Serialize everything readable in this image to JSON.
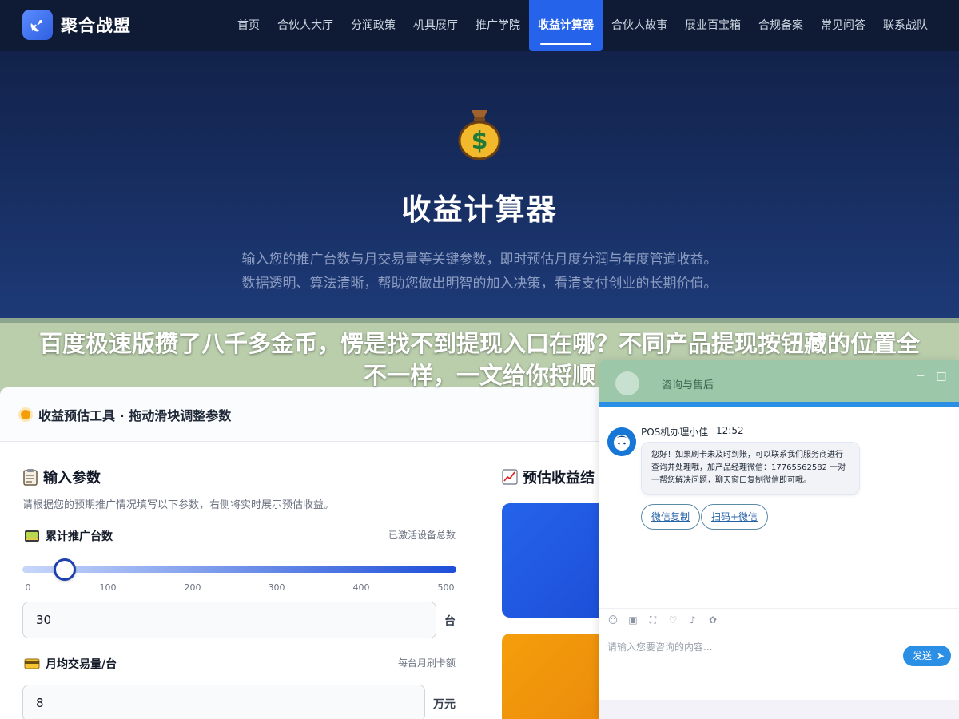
{
  "nav": {
    "brand": "聚合战盟",
    "items": [
      {
        "label": "首页"
      },
      {
        "label": "合伙人大厅"
      },
      {
        "label": "分润政策"
      },
      {
        "label": "机具展厅"
      },
      {
        "label": "推广学院"
      },
      {
        "label": "收益计算器",
        "active": true
      },
      {
        "label": "合伙人故事"
      },
      {
        "label": "展业百宝箱"
      },
      {
        "label": "合规备案"
      },
      {
        "label": "常见问答"
      },
      {
        "label": "联系战队"
      }
    ]
  },
  "hero": {
    "icon": "money-bag-icon",
    "title": "收益计算器",
    "description": "输入您的推广台数与月交易量等关键参数，即时预估月度分润与年度管道收益。数据透明、算法清晰，帮助您做出明智的加入决策，看清支付创业的长期价值。"
  },
  "overlay": {
    "headline": "百度极速版攒了八千多金币，愣是找不到提现入口在哪？不同产品提现按钮藏的位置全不一样，一文给你捋顺"
  },
  "calculator": {
    "header_title": "收益预估工具 · 拖动滑块调整参数",
    "input_section": {
      "icon": "clipboard-icon",
      "title": "输入参数",
      "description": "请根据您的预期推广情况填写以下参数，右侧将实时展示预估收益。"
    },
    "devices_field": {
      "icon": "pos-terminal-icon",
      "label": "累计推广台数",
      "hint": "已激活设备总数",
      "slider": {
        "min": 0,
        "max": 500,
        "value": 30
      },
      "ticks": [
        "0",
        "100",
        "200",
        "300",
        "400",
        "500"
      ],
      "value": "30",
      "unit": "台"
    },
    "volume_field": {
      "icon": "credit-card-icon",
      "label": "月均交易量/台",
      "hint": "每台月刷卡额",
      "value": "8",
      "unit": "万元"
    },
    "result_section": {
      "icon": "chart-up-icon",
      "title": "预估收益结"
    }
  },
  "chat": {
    "header_title": "咨询与售后",
    "agent_name": "POS机办理小佳",
    "time": "12:52",
    "message": "您好！如果刷卡未及时到账，可以联系我们服务商进行查询并处理哦，加产品经理微信：17765562582 一对一帮您解决问题，聊天窗口复制微信即可哦。",
    "buttons": [
      "微信复制",
      "扫码+微信"
    ],
    "input_placeholder": "请输入您要咨询的内容...",
    "send_label": "发送",
    "accent": "#2b8fe6"
  }
}
